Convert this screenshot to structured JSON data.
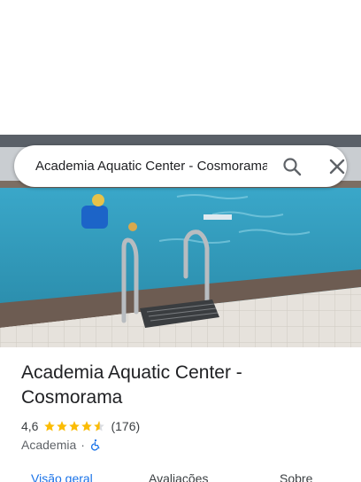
{
  "search": {
    "query": "Academia Aquatic Center - Cosmorama",
    "search_icon": "search-icon",
    "close_icon": "close-icon"
  },
  "place": {
    "title": "Academia Aquatic Center - Cosmorama",
    "rating": "4,6",
    "rating_value": 4.6,
    "review_count": "(176)",
    "category": "Academia",
    "separator": "·",
    "accessibility_icon": "wheelchair-icon"
  },
  "tabs": [
    {
      "label": "Visão geral",
      "active": true
    },
    {
      "label": "Avaliações",
      "active": false
    },
    {
      "label": "Sobre",
      "active": false
    }
  ],
  "colors": {
    "accent": "#1a73e8",
    "star": "#fbbc04",
    "text_primary": "#202124",
    "text_secondary": "#5f6368"
  }
}
